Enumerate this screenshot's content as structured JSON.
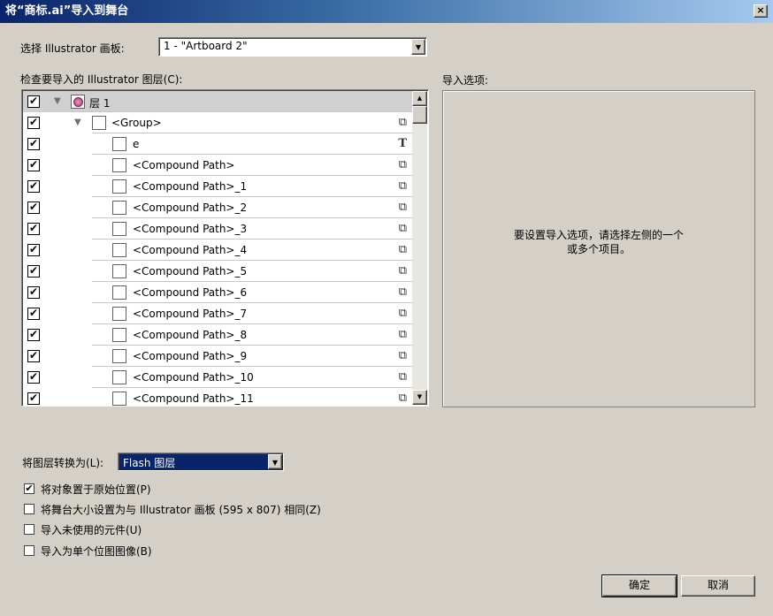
{
  "window": {
    "title": "将“商标.ai”导入到舞台",
    "close_label": "×"
  },
  "artboard": {
    "label": "选择 Illustrator 画板:",
    "value": "1 - \"Artboard 2\""
  },
  "layers": {
    "label": "检查要导入的 Illustrator 图层(C):",
    "rows": [
      {
        "name": "层 1",
        "checked": "✔",
        "icon": "layer-icon"
      },
      {
        "name": "<Group>",
        "checked": "✔",
        "icon": "group-icon"
      },
      {
        "name": "e",
        "checked": "✔",
        "icon": "text-icon"
      },
      {
        "name": "<Compound Path>",
        "checked": "✔",
        "icon": "compound-path-icon"
      },
      {
        "name": "<Compound Path>_1",
        "checked": "✔",
        "icon": "compound-path-icon"
      },
      {
        "name": "<Compound Path>_2",
        "checked": "✔",
        "icon": "compound-path-icon"
      },
      {
        "name": "<Compound Path>_3",
        "checked": "✔",
        "icon": "compound-path-icon"
      },
      {
        "name": "<Compound Path>_4",
        "checked": "✔",
        "icon": "compound-path-icon"
      },
      {
        "name": "<Compound Path>_5",
        "checked": "✔",
        "icon": "compound-path-icon"
      },
      {
        "name": "<Compound Path>_6",
        "checked": "✔",
        "icon": "compound-path-icon"
      },
      {
        "name": "<Compound Path>_7",
        "checked": "✔",
        "icon": "compound-path-icon"
      },
      {
        "name": "<Compound Path>_8",
        "checked": "✔",
        "icon": "compound-path-icon"
      },
      {
        "name": "<Compound Path>_9",
        "checked": "✔",
        "icon": "compound-path-icon"
      },
      {
        "name": "<Compound Path>_10",
        "checked": "✔",
        "icon": "compound-path-icon"
      },
      {
        "name": "<Compound Path>_11",
        "checked": "✔",
        "icon": "compound-path-icon"
      }
    ]
  },
  "import_options": {
    "label": "导入选项:",
    "message": "要设置导入选项，请选择左侧的一个或多个项目。"
  },
  "convert": {
    "label": "将图层转换为(L):",
    "value": "Flash 图层"
  },
  "checkboxes": [
    {
      "label": "将对象置于原始位置(P)",
      "checked": "✔"
    },
    {
      "label": "将舞台大小设置为与 Illustrator 画板 (595 x 807) 相同(Z)",
      "checked": ""
    },
    {
      "label": "导入未使用的元件(U)",
      "checked": ""
    },
    {
      "label": "导入为单个位图图像(B)",
      "checked": ""
    }
  ],
  "buttons": {
    "ok": "确定",
    "cancel": "取消"
  }
}
